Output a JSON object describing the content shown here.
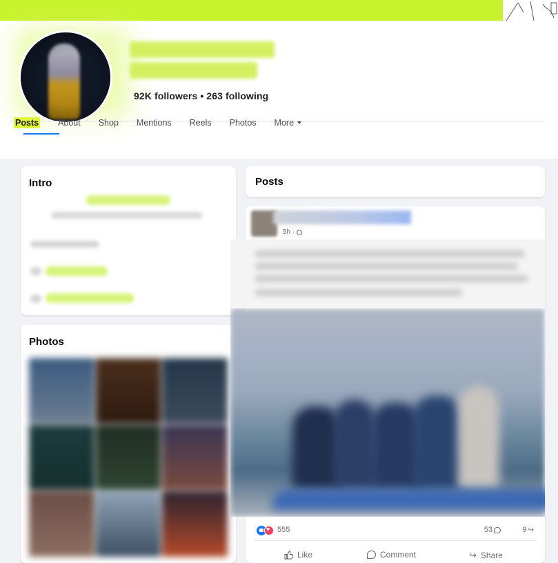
{
  "profile": {
    "followers_text": "92K followers • 263 following"
  },
  "tabs": [
    {
      "label": "Posts",
      "active": true
    },
    {
      "label": "About"
    },
    {
      "label": "Shop"
    },
    {
      "label": "Mentions"
    },
    {
      "label": "Reels"
    },
    {
      "label": "Photos"
    },
    {
      "label": "More"
    }
  ],
  "intro": {
    "title": "Intro"
  },
  "photos": {
    "title": "Photos"
  },
  "posts": {
    "title": "Posts"
  },
  "post": {
    "time": "5h ·",
    "reaction_count": "555",
    "comment_count": "53",
    "share_count": "9",
    "actions": {
      "like": "Like",
      "comment": "Comment",
      "share": "Share"
    }
  },
  "colors": {
    "accent": "#c8f22b",
    "facebook_blue": "#1877f2",
    "background": "#f0f2f5"
  }
}
